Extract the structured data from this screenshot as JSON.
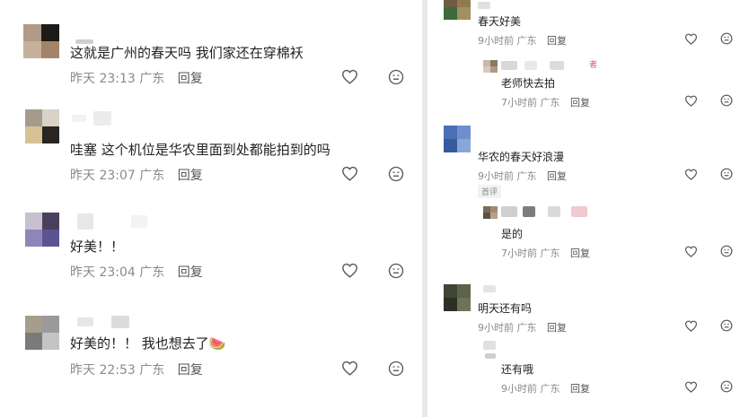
{
  "left": {
    "comments": [
      {
        "text": "这就是广州的春天吗 我们家还在穿棉袄",
        "date": "昨天",
        "time": "23:13",
        "location": "广东",
        "reply": "回复"
      },
      {
        "text": "哇塞 这个机位是华农里面到处都能拍到的吗",
        "date": "昨天",
        "time": "23:07",
        "location": "广东",
        "reply": "回复"
      },
      {
        "text": "好美！！",
        "date": "昨天",
        "time": "23:04",
        "location": "广东",
        "reply": "回复"
      },
      {
        "text": "好美的！！ 我也想去了",
        "emoji": "🍉",
        "date": "昨天",
        "time": "22:53",
        "location": "广东",
        "reply": "回复"
      }
    ]
  },
  "right": {
    "items": [
      {
        "text": "春天好美",
        "time": "9小时前",
        "location": "广东",
        "reply": "回复"
      },
      {
        "text": "老师快去拍",
        "time": "7小时前",
        "location": "广东",
        "reply": "回复",
        "author_tag": "者"
      },
      {
        "text": "华农的春天好浪漫",
        "time": "9小时前",
        "location": "广东",
        "reply": "回复",
        "badge": "首评"
      },
      {
        "text": "是的",
        "time": "7小时前",
        "location": "广东",
        "reply": "回复"
      },
      {
        "text": "明天还有吗",
        "time": "9小时前",
        "location": "广东",
        "reply": "回复"
      },
      {
        "text": "还有哦",
        "time": "9小时前",
        "location": "广东",
        "reply": "回复"
      }
    ]
  },
  "icons": {
    "like": "heart-outline-icon",
    "dislike": "dislike-face-icon"
  },
  "colors": {
    "meta_gray": "#8a8a8a",
    "divider": "#e9e9e9",
    "author_tag": "#e0506a"
  }
}
